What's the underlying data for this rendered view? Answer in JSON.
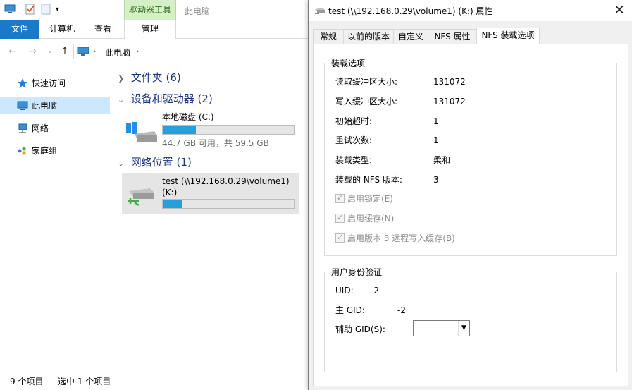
{
  "explorer": {
    "contextual_tab": "驱动器工具",
    "window_title": "此电脑",
    "ribbon_tabs": {
      "file": "文件",
      "computer": "计算机",
      "view": "查看",
      "manage": "管理"
    },
    "address": {
      "path": "此电脑",
      "separator": "›"
    },
    "nav": {
      "back": "←",
      "forward": "→",
      "recent": "⌄",
      "up": "↑",
      "items": [
        {
          "label": "快速访问",
          "icon": "star-icon"
        },
        {
          "label": "此电脑",
          "icon": "computer-icon"
        },
        {
          "label": "网络",
          "icon": "network-icon"
        },
        {
          "label": "家庭组",
          "icon": "homegroup-icon"
        }
      ]
    },
    "groups": {
      "folders": "文件夹 (6)",
      "devices": "设备和驱动器 (2)",
      "network": "网络位置 (1)"
    },
    "drives": {
      "local": {
        "name": "本地磁盘 (C:)",
        "usage": "44.7 GB 可用，共 59.5 GB",
        "used_fraction": 0.25
      },
      "network": {
        "name": "test (\\\\192.168.0.29\\volume1)\n(K:)",
        "used_fraction": 0.15
      }
    },
    "status": {
      "count": "9 个项目",
      "selected": "选中 1 个项目"
    }
  },
  "dialog": {
    "title": "test (\\\\192.168.0.29\\volume1) (K:) 属性",
    "close": "✕",
    "tabs": [
      "常规",
      "以前的版本",
      "自定义",
      "NFS 属性",
      "NFS 装载选项"
    ],
    "mount": {
      "legend": "装载选项",
      "rows": [
        {
          "label": "读取缓冲区大小:",
          "value": "131072"
        },
        {
          "label": "写入缓冲区大小:",
          "value": "131072"
        },
        {
          "label": "初始超时:",
          "value": "1"
        },
        {
          "label": "重试次数:",
          "value": "1"
        },
        {
          "label": "装载类型:",
          "value": "柔和"
        },
        {
          "label": "装载的 NFS 版本:",
          "value": "3"
        }
      ],
      "checks": [
        "启用锁定(E)",
        "启用缓存(N)",
        "启用版本 3 远程写入缓存(B)"
      ]
    },
    "auth": {
      "legend": "用户身份验证",
      "uid_label": "UID:",
      "uid_value": "-2",
      "gid_label": "主 GID:",
      "gid_value": "-2",
      "aux_label": "辅助 GID(S):",
      "aux_value": ""
    }
  },
  "colors": {
    "accent": "#1979ca",
    "progress": "#26a0da",
    "context_tab": "#d5f0c4"
  }
}
